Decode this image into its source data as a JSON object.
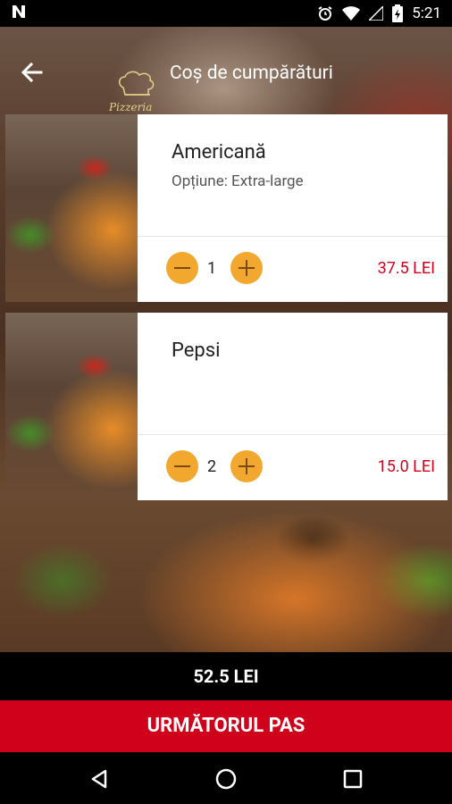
{
  "status_bar": {
    "time": "5:21",
    "notification_icon": "n-notification-icon",
    "icons": [
      "alarm-icon",
      "wifi-icon",
      "signal-icon",
      "battery-charging-icon"
    ]
  },
  "app_bar": {
    "title": "Coș de cumpărături",
    "logo_text": "Pizzeria Florina"
  },
  "cart": {
    "items": [
      {
        "name": "Americană",
        "option": "Opțiune: Extra-large",
        "quantity": "1",
        "price": "37.5 LEI"
      },
      {
        "name": "Pepsi",
        "option": "",
        "quantity": "2",
        "price": "15.0 LEI"
      }
    ]
  },
  "total": "52.5 LEI",
  "next_button": "URMĂTORUL PAS",
  "colors": {
    "accent": "#d0021b",
    "stepper": "#f2a72e",
    "bar": "#000000"
  }
}
